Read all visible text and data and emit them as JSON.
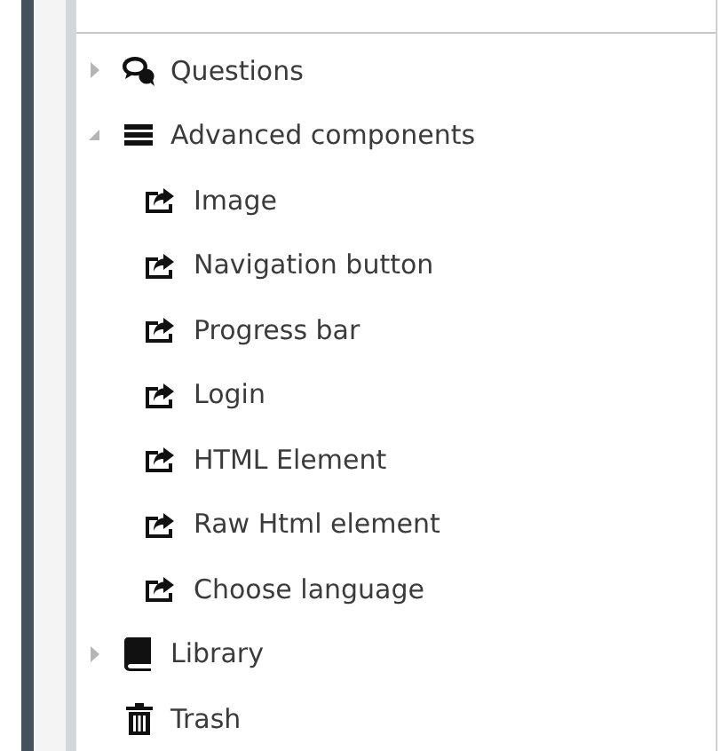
{
  "tree": [
    {
      "label": "Questions",
      "kind": "questions",
      "expanded": false
    },
    {
      "label": "Advanced components",
      "kind": "list",
      "expanded": true,
      "children": [
        {
          "label": "Image",
          "kind": "component"
        },
        {
          "label": "Navigation button",
          "kind": "component"
        },
        {
          "label": "Progress bar",
          "kind": "component"
        },
        {
          "label": "Login",
          "kind": "component"
        },
        {
          "label": "HTML Element",
          "kind": "component"
        },
        {
          "label": "Raw Html element",
          "kind": "component"
        },
        {
          "label": "Choose language",
          "kind": "component"
        }
      ]
    },
    {
      "label": "Library",
      "kind": "library",
      "expanded": false
    },
    {
      "label": "Trash",
      "kind": "trash"
    }
  ]
}
